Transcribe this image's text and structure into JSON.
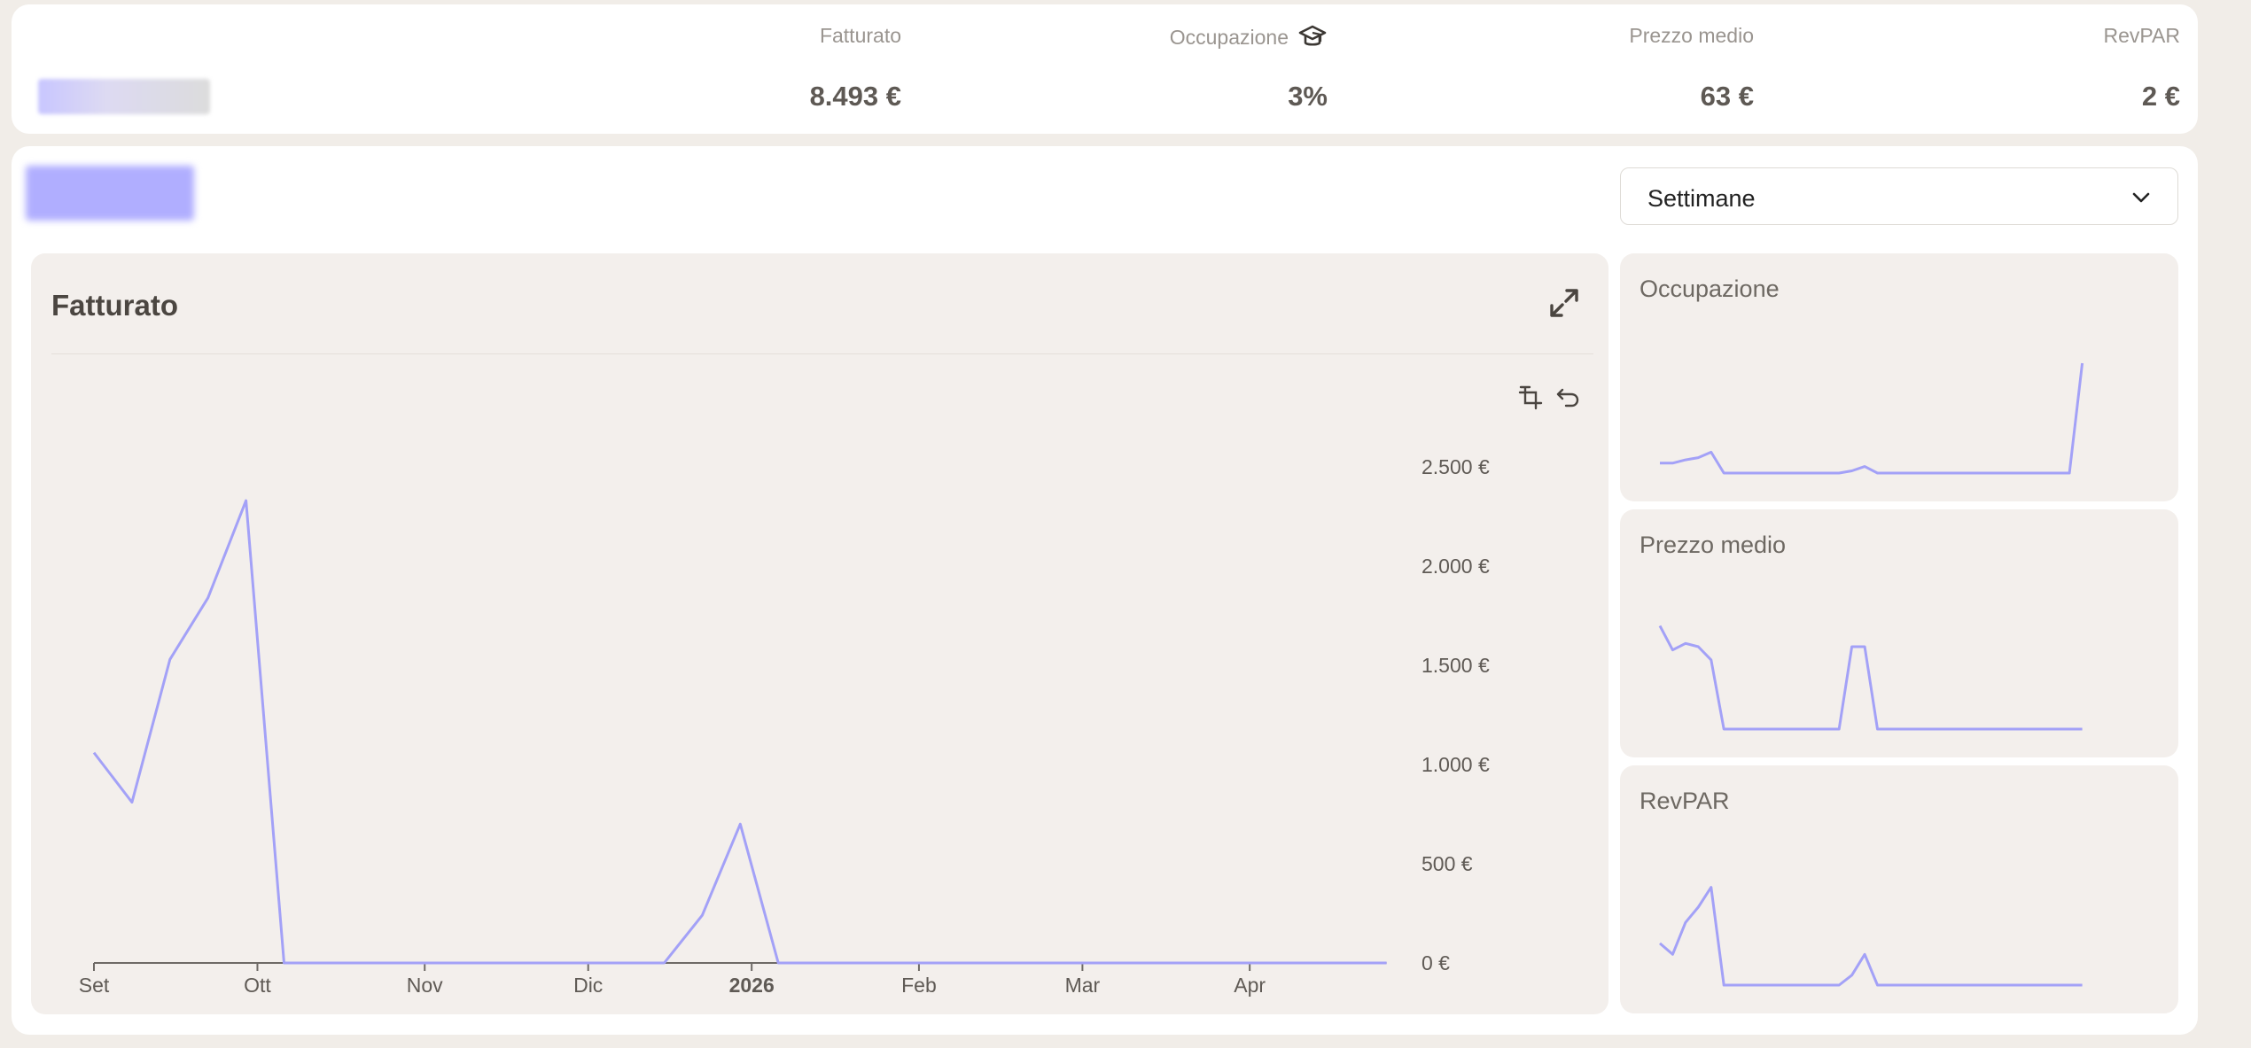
{
  "summary": {
    "metrics": [
      {
        "label": "Fatturato",
        "value": "8.493 €"
      },
      {
        "label": "Occupazione",
        "value": "3%",
        "icon": "graduation-cap-icon"
      },
      {
        "label": "Prezzo medio",
        "value": "63 €"
      },
      {
        "label": "RevPAR",
        "value": "2 €"
      }
    ]
  },
  "period_select": {
    "value": "Settimane"
  },
  "main_chart": {
    "title": "Fatturato"
  },
  "mini_charts": [
    {
      "title": "Occupazione"
    },
    {
      "title": "Prezzo medio"
    },
    {
      "title": "RevPAR"
    }
  ],
  "colors": {
    "line": "#a3a1f7",
    "axis": "#6e6a66"
  },
  "chart_data": [
    {
      "type": "line",
      "title": "Fatturato",
      "x_tick_labels": [
        "Set",
        "Ott",
        "Nov",
        "Dic",
        "2026",
        "Feb",
        "Mar",
        "Apr"
      ],
      "x_tick_index": [
        0,
        4.3,
        8.7,
        13,
        17.3,
        21.7,
        26,
        30.4
      ],
      "y_tick_labels": [
        "0 €",
        "500 €",
        "1.000 €",
        "1.500 €",
        "2.000 €",
        "2.500 €"
      ],
      "ylim": [
        0,
        2500
      ],
      "series": [
        {
          "values": [
            1060,
            810,
            1530,
            1840,
            2330,
            0,
            0,
            0,
            0,
            0,
            0,
            0,
            0,
            0,
            0,
            0,
            240,
            700,
            0,
            0,
            0,
            0,
            0,
            0,
            0,
            0,
            0,
            0,
            0,
            0,
            0,
            0,
            0,
            0,
            0
          ]
        }
      ]
    },
    {
      "type": "line",
      "title": "Occupazione",
      "series": [
        {
          "values": [
            0.09,
            0.09,
            0.12,
            0.14,
            0.19,
            0,
            0,
            0,
            0,
            0,
            0,
            0,
            0,
            0,
            0,
            0.02,
            0.06,
            0,
            0,
            0,
            0,
            0,
            0,
            0,
            0,
            0,
            0,
            0,
            0,
            0,
            0,
            0,
            0,
            1.0
          ]
        }
      ]
    },
    {
      "type": "line",
      "title": "Prezzo medio",
      "series": [
        {
          "values": [
            0.94,
            0.72,
            0.78,
            0.75,
            0.63,
            0,
            0,
            0,
            0,
            0,
            0,
            0,
            0,
            0,
            0,
            0.75,
            0.75,
            0,
            0,
            0,
            0,
            0,
            0,
            0,
            0,
            0,
            0,
            0,
            0,
            0,
            0,
            0,
            0,
            0
          ]
        }
      ]
    },
    {
      "type": "line",
      "title": "RevPAR",
      "series": [
        {
          "values": [
            0.38,
            0.28,
            0.57,
            0.71,
            0.89,
            0,
            0,
            0,
            0,
            0,
            0,
            0,
            0,
            0,
            0,
            0.09,
            0.28,
            0,
            0,
            0,
            0,
            0,
            0,
            0,
            0,
            0,
            0,
            0,
            0,
            0,
            0,
            0,
            0,
            0
          ]
        }
      ]
    }
  ]
}
